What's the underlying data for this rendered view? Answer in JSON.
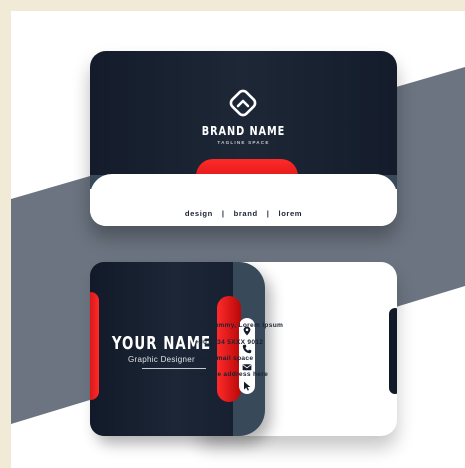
{
  "background": {
    "page": "#f1ead6",
    "canvas": "#ffffff",
    "stripe": "#6b7480"
  },
  "colors": {
    "navy": "#141c2b",
    "slate": "#38495a",
    "red": "#e01414",
    "text_dark": "#1a2333"
  },
  "front_card": {
    "logo_icon": "rounded-diamond-chevron-logo",
    "brand_name": "BRAND NAME",
    "tagline": "TAGLINE SPACE",
    "links": [
      "design",
      "brand",
      "lorem"
    ],
    "separator": "|"
  },
  "back_card": {
    "name": "YOUR NAME",
    "job_title": "Graphic Designer",
    "contacts": [
      {
        "icon": "location-pin-icon",
        "text": "123 Dummy, Lorem Ipsum"
      },
      {
        "icon": "phone-icon",
        "text": "+00 1234 5XXX 9012"
      },
      {
        "icon": "envelope-icon",
        "text": "your email space"
      },
      {
        "icon": "cursor-icon",
        "text": "website address here"
      }
    ]
  }
}
